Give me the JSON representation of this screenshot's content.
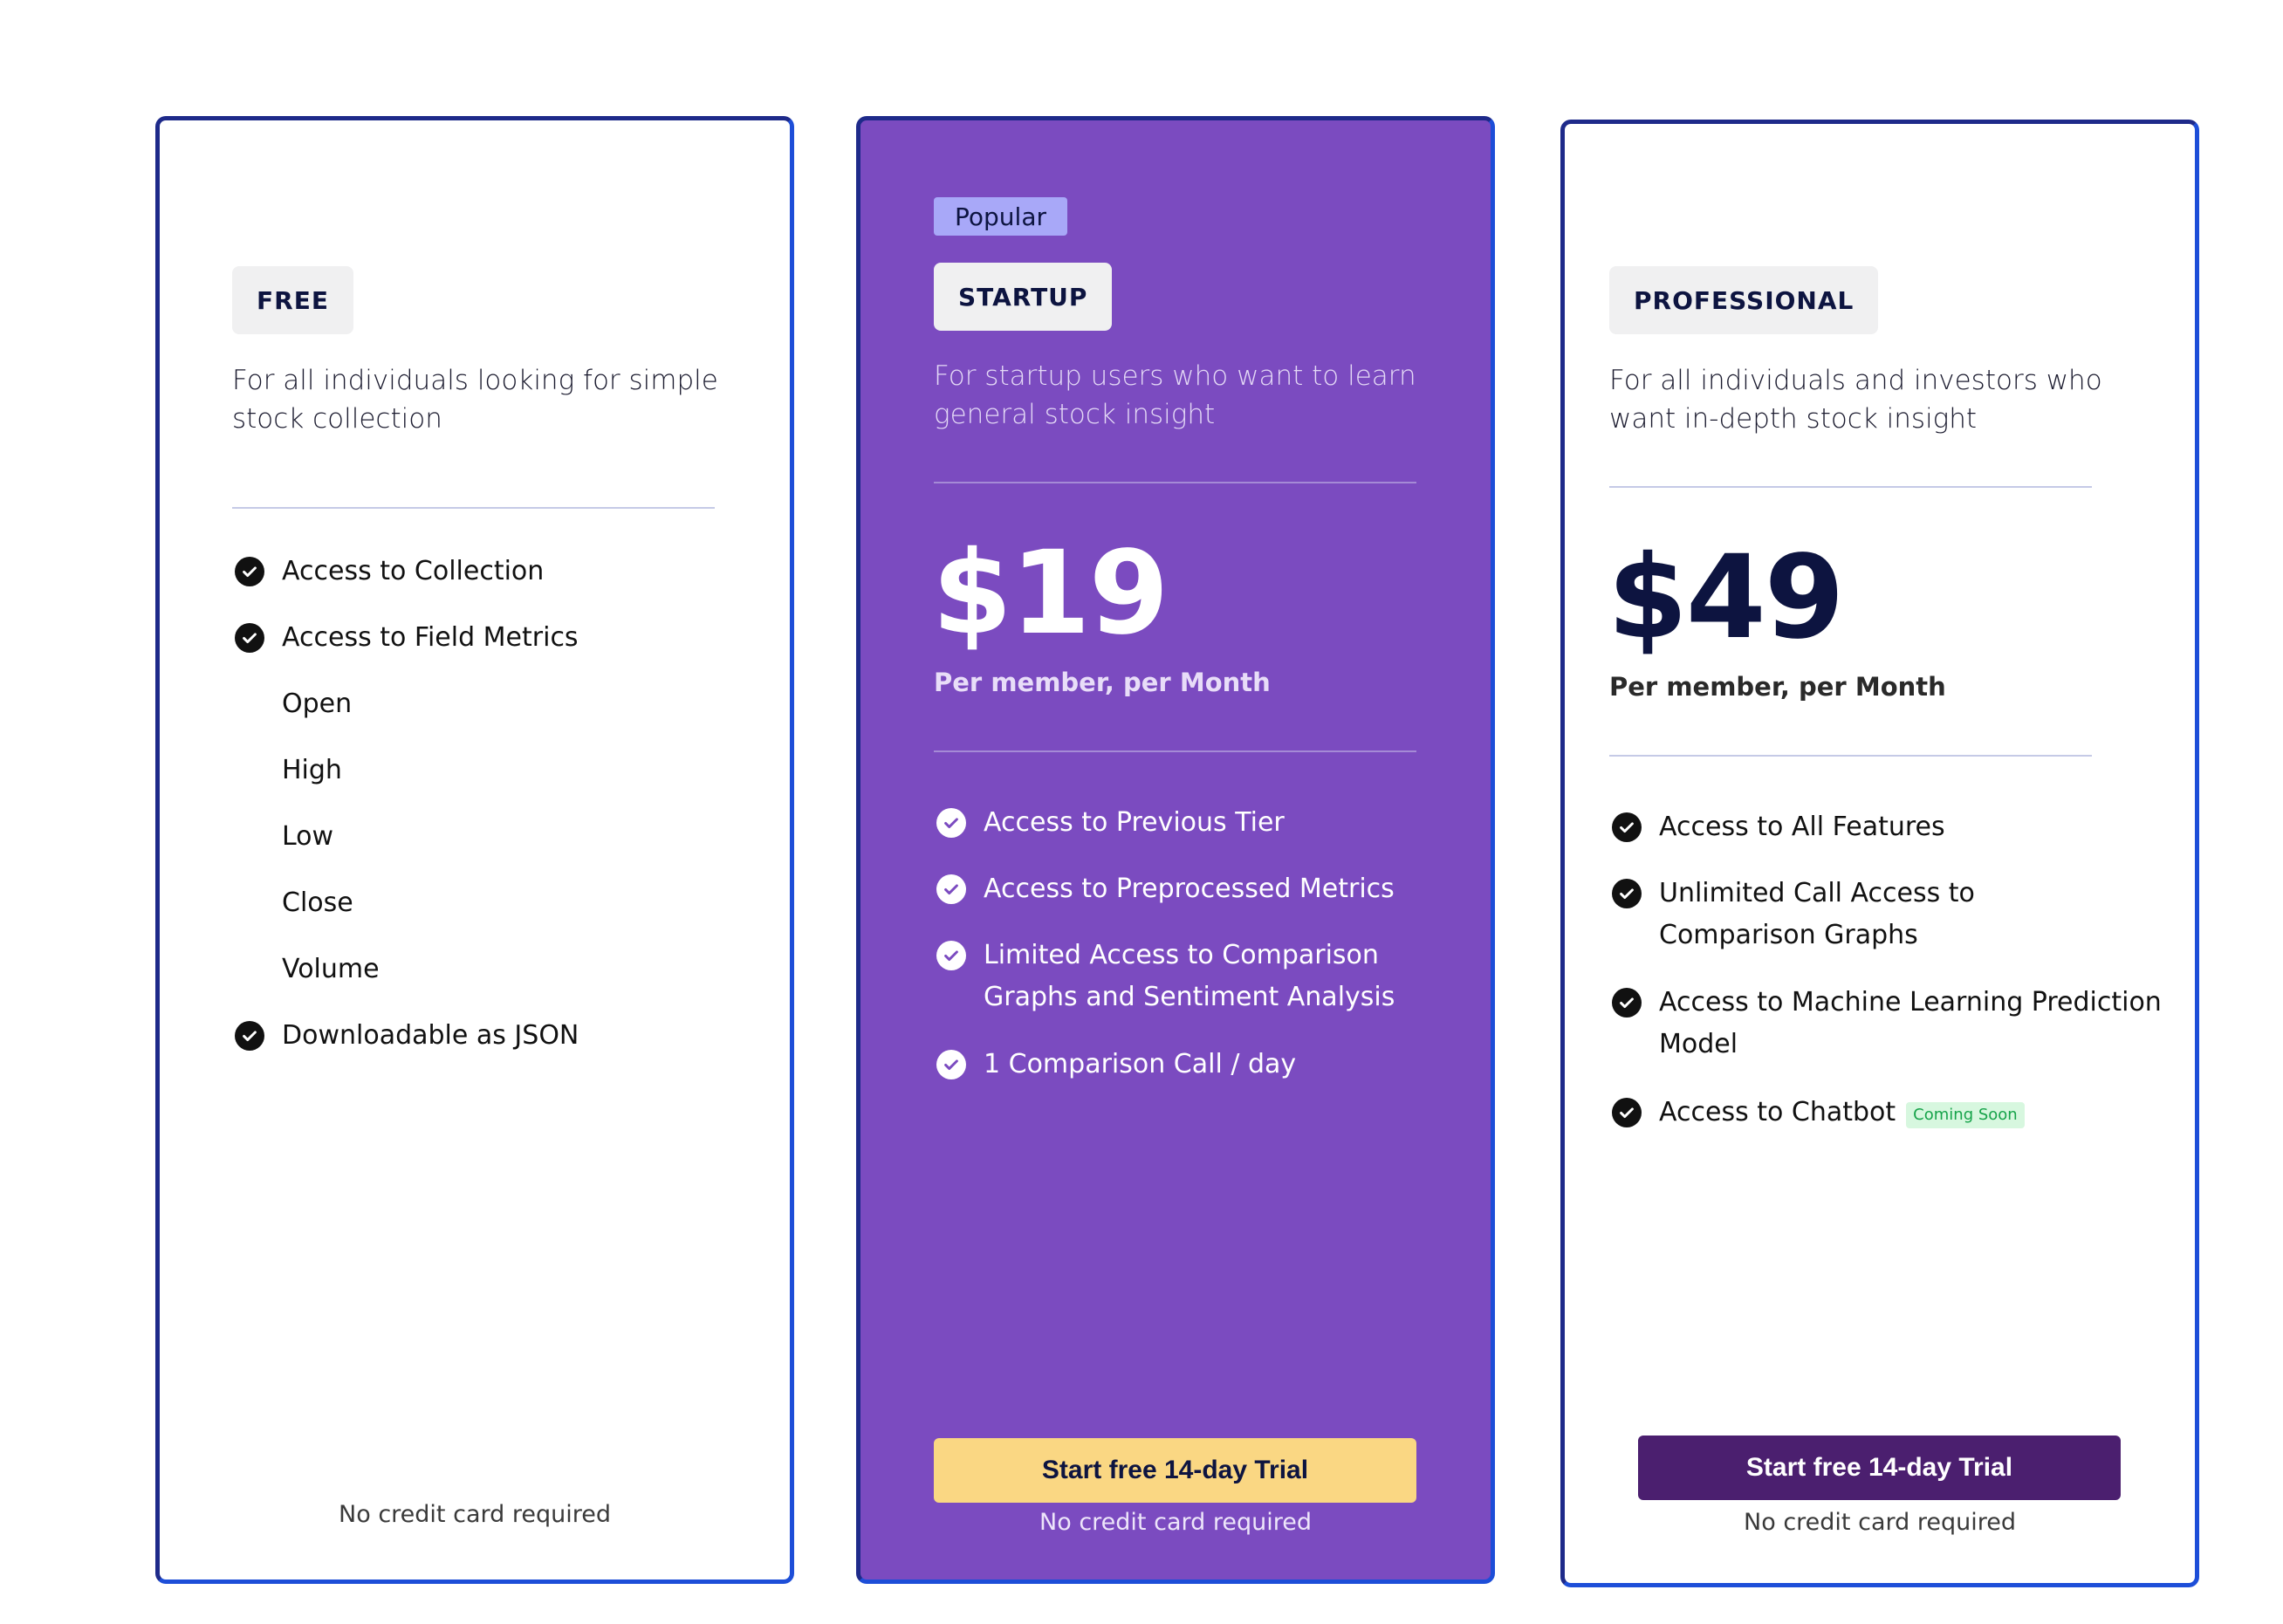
{
  "colors": {
    "card_border": "#1d4ed8",
    "startup_bg": "#7b4bc0",
    "popular_badge_bg": "#a8a8f8",
    "startup_cta_bg": "#fad783",
    "pro_cta_bg": "#4b1f6f",
    "coming_soon_bg": "#d7f7df",
    "coming_soon_text": "#16a34a"
  },
  "plans": {
    "free": {
      "tier": "FREE",
      "description": "For all individuals looking for simple stock collection",
      "features": [
        "Access to Collection",
        "Access to Field Metrics"
      ],
      "metrics": [
        "Open",
        "High",
        "Low",
        "Close",
        "Volume"
      ],
      "extra_feature": "Downloadable as JSON",
      "note": "No credit card required",
      "icon": "check-circle-icon"
    },
    "startup": {
      "popular_label": "Popular",
      "tier": "STARTUP",
      "description": "For startup users who want to learn general stock insight",
      "price": "$19",
      "price_period": "Per member, per Month",
      "features": [
        "Access to Previous Tier",
        "Access to Preprocessed Metrics",
        "Limited Access to Comparison Graphs and Sentiment Analysis",
        "1 Comparison Call / day"
      ],
      "cta_label": "Start free 14-day Trial",
      "note": "No credit card required",
      "icon": "check-circle-icon"
    },
    "professional": {
      "tier": "PROFESSIONAL",
      "description": "For all individuals and investors who want in-depth stock insight",
      "price": "$49",
      "price_period": "Per member, per Month",
      "features": [
        "Access to All Features",
        "Unlimited Call Access to Comparison Graphs",
        "Access to Machine Learning Prediction Model",
        "Access to Chatbot"
      ],
      "coming_soon_label": "Coming Soon",
      "cta_label": "Start free 14-day Trial",
      "note": "No credit card required",
      "icon": "check-circle-icon"
    }
  }
}
